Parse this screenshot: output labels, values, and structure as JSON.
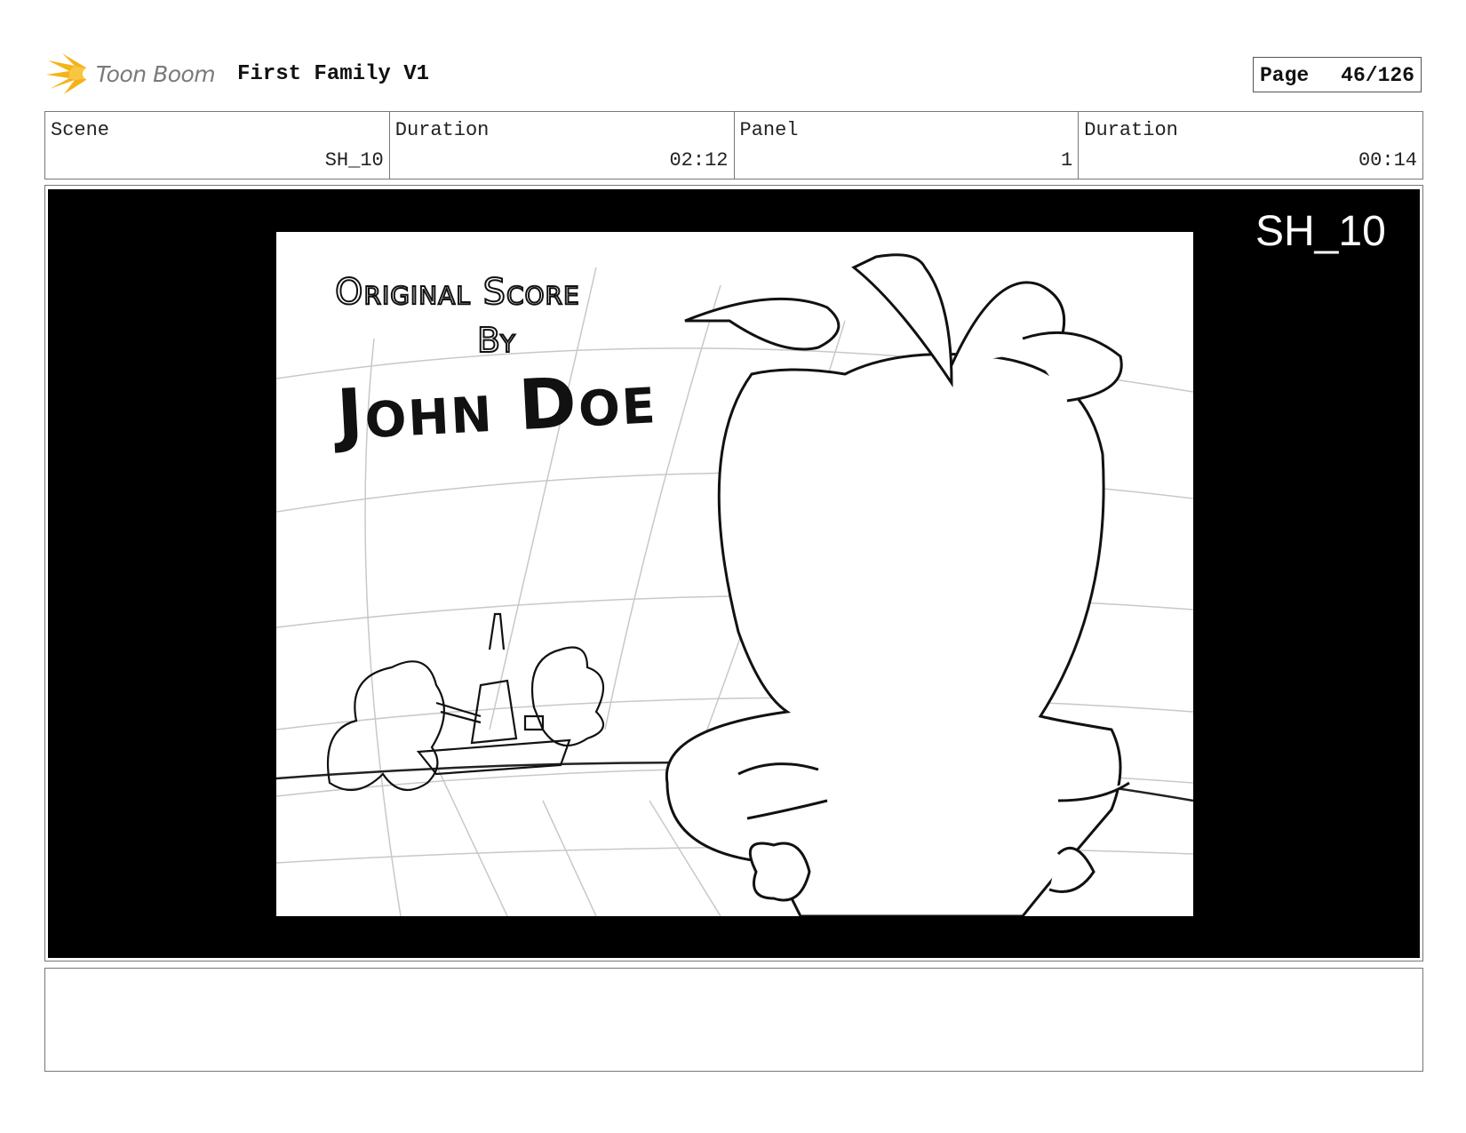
{
  "header": {
    "logo_text": "Toon Boom",
    "logo_icon": "starburst-icon",
    "project_title": "First Family V1",
    "page_label": "Page",
    "page_value": "46/126"
  },
  "info": {
    "scene_label": "Scene",
    "scene_value": "SH_10",
    "scene_duration_label": "Duration",
    "scene_duration_value": "02:12",
    "panel_label": "Panel",
    "panel_value": "1",
    "panel_duration_label": "Duration",
    "panel_duration_value": "00:14"
  },
  "panel": {
    "shot_label": "SH_10",
    "credit_line1": "Original Score",
    "credit_line2": "By",
    "credit_line3": "John Doe"
  },
  "notes": {
    "text": ""
  },
  "colors": {
    "frame_background": "#000000",
    "logo_orange": "#f5b31a",
    "border_gray": "#777777"
  }
}
